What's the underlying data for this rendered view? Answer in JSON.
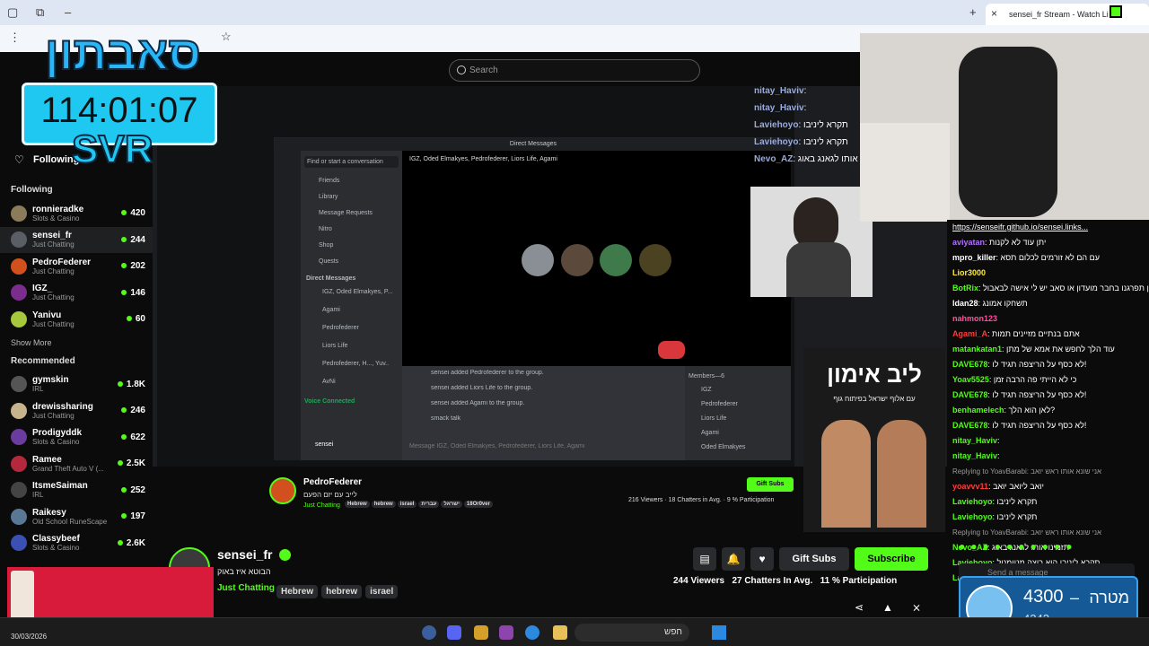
{
  "browser": {
    "active_tab": "sensei_fr Stream - Watch Li",
    "new_tab": "+",
    "close": "×"
  },
  "search": {
    "placeholder": "Search"
  },
  "logo": {
    "timer": "114:01:07",
    "tag": "SVR",
    "hebrew": "סאבתון"
  },
  "sidebar": {
    "following_label": "Following",
    "following_header": "Following",
    "following": [
      {
        "name": "ronnieradke",
        "cat": "Slots & Casino",
        "count": "420",
        "color": "#8c7b5a"
      },
      {
        "name": "sensei_fr",
        "cat": "Just Chatting",
        "count": "244",
        "color": "#5a5f66"
      },
      {
        "name": "PedroFederer",
        "cat": "Just Chatting",
        "count": "202",
        "color": "#d2501e"
      },
      {
        "name": "IGZ_",
        "cat": "Just Chatting",
        "count": "146",
        "color": "#7a2d8c"
      },
      {
        "name": "Yanivu",
        "cat": "Just Chatting",
        "count": "60",
        "color": "#a5c83c"
      }
    ],
    "show_more": "Show More",
    "recommended_header": "Recommended",
    "recommended": [
      {
        "name": "gymskin",
        "cat": "IRL",
        "count": "1.8K",
        "color": "#555"
      },
      {
        "name": "drewissharing",
        "cat": "Just Chatting",
        "count": "246",
        "color": "#c8b48c"
      },
      {
        "name": "Prodigyddk",
        "cat": "Slots & Casino",
        "count": "622",
        "color": "#6a3ca0"
      },
      {
        "name": "Ramee",
        "cat": "Grand Theft Auto V (...",
        "count": "2.5K",
        "color": "#b4283c"
      },
      {
        "name": "ItsmeSaiman",
        "cat": "IRL",
        "count": "252",
        "color": "#444"
      },
      {
        "name": "Raikesy",
        "cat": "Old School RuneScape",
        "count": "197",
        "color": "#5a7896"
      },
      {
        "name": "Classybeef",
        "cat": "Slots & Casino",
        "count": "2.6K",
        "color": "#3c50b4"
      }
    ]
  },
  "inner_overlay_chat": [
    {
      "name": "nitay_Haviv",
      "text": ":"
    },
    {
      "name": "nitay_Haviv",
      "text": ":"
    },
    {
      "name": "Laviehoyo",
      "text": ": תקרא ליניבו"
    },
    {
      "name": "Laviehoyo",
      "text": ": תקרא ליניבו"
    },
    {
      "name": "Nevo_AZ",
      "text": ": תזמינו אותו לגאנג באוג"
    }
  ],
  "ad": {
    "title": "ליב אימון",
    "subtitle": "עם אלוף ישראל בפיתוח גוף"
  },
  "inner_stream": {
    "streamer": "PedroFederer",
    "title": "לייב עם יזם הפעם",
    "category": "Just Chatting",
    "tags": [
      "Hebrew",
      "hebrew",
      "israel",
      "עברית",
      "ישראל",
      "18Or0ver"
    ],
    "viewers": "216 Viewers",
    "chatters": "18 Chatters in Avg.",
    "participation": "9 % Participation",
    "gift_subs": "Gift Subs"
  },
  "discord": {
    "header": "Direct Messages",
    "find": "Find or start a conversation",
    "dm_name": "IGZ, Oded Elmakyes, Pedrofederer, Liors Life, Agami",
    "menu": [
      "Friends",
      "Library",
      "Message Requests",
      "Nitro",
      "Shop",
      "Quests"
    ],
    "dm_section": "Direct Messages",
    "dms": [
      "IGZ, Oded Elmakyes, P...",
      "Agami",
      "Pedrofederer",
      "Liors Life",
      "Pedrofederer, H..., Yuv..",
      "AvNi"
    ],
    "voice": "Voice Connected",
    "user": "sensei",
    "log": [
      "sensei added Pedrofederer to the group.",
      "sensei added Liors Life to the group.",
      "sensei added Agami to the group.",
      "smack talk"
    ],
    "members_header": "Members—6",
    "members": [
      "IGZ",
      "Pedrofederer",
      "Liors Life",
      "Agami",
      "Oded Elmakyes"
    ],
    "input": "Message IGZ, Oded Elmakyes, Pedrofederer, Liors Life, Agami"
  },
  "chat": {
    "lines": [
      {
        "type": "link",
        "text": "https://senseifr.github.io/sensei.links..."
      },
      {
        "name": "aviyatan",
        "color": "#b070ff",
        "text": ": יתן עוד לא לקנות"
      },
      {
        "name": "mpro_killer",
        "color": "#ffffff",
        "text": ": עם הם לא זורמים לכלום תסא"
      },
      {
        "name": "Lior3000",
        "color": "#ffeb3b",
        "text": ""
      },
      {
        "name": "BotRix",
        "color": "#53fc18",
        "text": ": מתוכן תפרגנו בחבר מועדון או סאב יש לי אישה לבאבול"
      },
      {
        "name": "ldan28",
        "color": "#ffffff",
        "text": ": תשחקו אמונג"
      },
      {
        "name": "nahmon123",
        "color": "#ff4fa0",
        "text": ""
      },
      {
        "name": "Agami_A",
        "color": "#ff3b3b",
        "text": ": אתם בנתיים מזיינים תמות"
      },
      {
        "name": "matankatan1",
        "color": "#53fc18",
        "text": ": עוד הלך לחפש את אמא של מתן"
      },
      {
        "name": "DAVE678",
        "color": "#53fc18",
        "text": ": לא כסף על הריצפה תגיד לו!"
      },
      {
        "name": "Yoav5525",
        "color": "#53fc18",
        "text": ": כי לא הייתי פה הרבה זמן"
      },
      {
        "name": "DAVE678",
        "color": "#53fc18",
        "text": ": לא כסף על הריצפה תגיד לו!"
      },
      {
        "name": "benhamelech",
        "color": "#53fc18",
        "text": ": לאן הוא הלך?"
      },
      {
        "name": "DAVE678",
        "color": "#53fc18",
        "text": ": לא כסף על הריצפה תגיד לו!"
      },
      {
        "name": "nitay_Haviv",
        "color": "#53fc18",
        "text": ":"
      },
      {
        "name": "nitay_Haviv",
        "color": "#53fc18",
        "text": ":"
      },
      {
        "type": "reply",
        "text": "Replying to YoavBarabi: אני שונא אותו ראש יואב"
      },
      {
        "name": "yoavvv11",
        "color": "#ff3b3b",
        "text": ": יואב ליואב יואב"
      },
      {
        "name": "Laviehoyo",
        "color": "#53fc18",
        "text": ": תקרא ליניבו"
      },
      {
        "name": "Laviehoyo",
        "color": "#53fc18",
        "text": ": תקרא ליניבו"
      },
      {
        "type": "reply",
        "text": "Replying to YoavBarabi: אני שונא אותו ראש יואב"
      },
      {
        "name": "Nevo_AZ",
        "color": "#53fc18",
        "text": ": תזמינו אותו לגאנג באוג"
      },
      {
        "name": "Laviehoyo",
        "color": "#53fc18",
        "text": ": תקרא ליניבו הוא רוצה מטומטל"
      },
      {
        "name": "Laviehoyo",
        "color": "#53fc18",
        "text": ": תקרא ליניבו הוא רוצה מטומטל"
      }
    ],
    "input_placeholder": "Send a message"
  },
  "stream": {
    "name": "sensei_fr",
    "title": "הבוטא איז באוק",
    "category": "Just Chatting",
    "tags": [
      "Hebrew",
      "hebrew",
      "israel"
    ],
    "gift_subs": "Gift Subs",
    "subscribe": "Subscribe",
    "viewers": "244 Viewers",
    "chatters": "27 Chatters In Avg.",
    "participation": "11 % Participation"
  },
  "goal": {
    "label": "מטרה",
    "current": "4300",
    "dash": "–",
    "sub": "4242"
  },
  "taskbar": {
    "date": "30/03/2026",
    "search_label": "חפש"
  },
  "colors": {
    "kick_green": "#53fc18",
    "bg": "#0b0b0c"
  }
}
